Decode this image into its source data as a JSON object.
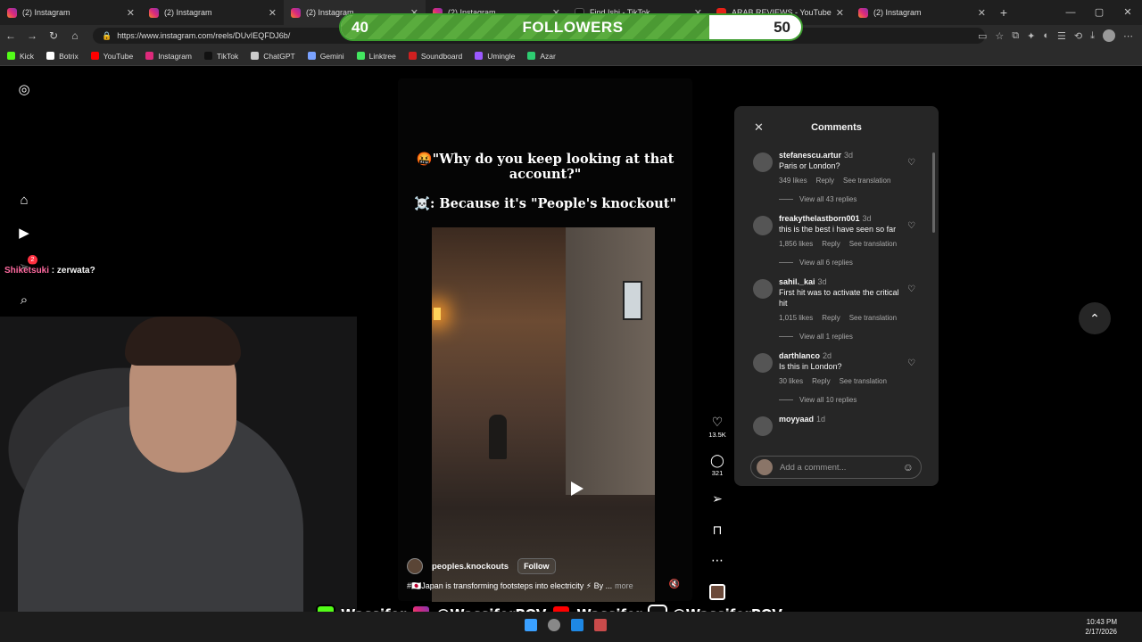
{
  "browser": {
    "tabs": [
      {
        "title": "(2) Instagram",
        "kind": "ig",
        "active": false
      },
      {
        "title": "(2) Instagram",
        "kind": "ig",
        "active": false
      },
      {
        "title": "(2) Instagram",
        "kind": "ig",
        "active": true
      },
      {
        "title": "(2) Instagram",
        "kind": "ig",
        "active": false
      },
      {
        "title": "Find Ishi - TikTok",
        "kind": "tt",
        "active": false
      },
      {
        "title": "ARAB REVIEWS - YouTube",
        "kind": "yt",
        "active": false
      },
      {
        "title": "(2) Instagram",
        "kind": "ig",
        "active": false
      }
    ],
    "url": "https://www.instagram.com/reels/DUvIEQFDJ6b/",
    "bookmarks": [
      {
        "label": "Kick",
        "color": "#53fc18"
      },
      {
        "label": "Botrix",
        "color": "#ffffff"
      },
      {
        "label": "YouTube",
        "color": "#ff0000"
      },
      {
        "label": "Instagram",
        "color": "#dd2a7b"
      },
      {
        "label": "TikTok",
        "color": "#111111"
      },
      {
        "label": "ChatGPT",
        "color": "#cccccc"
      },
      {
        "label": "Gemini",
        "color": "#7aa2ff"
      },
      {
        "label": "Linktree",
        "color": "#43e660"
      },
      {
        "label": "Soundboard",
        "color": "#d02020"
      },
      {
        "label": "Umingle",
        "color": "#9b59ff"
      },
      {
        "label": "Azar",
        "color": "#2ecc71"
      }
    ]
  },
  "overlay": {
    "followers_current": "40",
    "followers_label": "FOLLOWERS",
    "followers_goal": "50",
    "followers_progress": 0.8,
    "chat_user": "Shiketsuki",
    "chat_message": " : zerwata?",
    "socials": [
      "Wassifer",
      "@WassiferPOV",
      "Wassifer",
      "@WassiferPOV"
    ]
  },
  "reel": {
    "caption_line1": "🤬\"Why do you keep looking at that account?\"",
    "caption_line2": "☠️: Because it's \"People's knockout\"",
    "author": "peoples.knockouts",
    "follow_label": "Follow",
    "description": "#🇯🇵Japan is transforming footsteps into electricity ⚡ By ...",
    "more_label": "more",
    "likes": "13.5K",
    "comments_count": "321"
  },
  "comments_panel": {
    "title": "Comments",
    "items": [
      {
        "user": "stefanescu.artur",
        "time": "3d",
        "text": "Paris or London?",
        "likes": "349 likes",
        "reply": "Reply",
        "translate": "See translation",
        "replies": "View all 43 replies"
      },
      {
        "user": "freakythelastborn001",
        "time": "3d",
        "text": "this is the best i have seen so far",
        "likes": "1,856 likes",
        "reply": "Reply",
        "translate": "See translation",
        "replies": "View all 6 replies"
      },
      {
        "user": "sahil._kai",
        "time": "3d",
        "text": "First hit was to activate the critical hit",
        "likes": "1,015 likes",
        "reply": "Reply",
        "translate": "See translation",
        "replies": "View all 1 replies"
      },
      {
        "user": "darthlanco",
        "time": "2d",
        "text": "Is this in London?",
        "likes": "30 likes",
        "reply": "Reply",
        "translate": "See translation",
        "replies": "View all 10 replies"
      },
      {
        "user": "moyyaad",
        "time": "1d",
        "text": "",
        "likes": "",
        "reply": "",
        "translate": "",
        "replies": ""
      }
    ],
    "add_placeholder": "Add a comment..."
  },
  "taskbar": {
    "time": "10:43 PM",
    "date": "2/17/2026"
  }
}
